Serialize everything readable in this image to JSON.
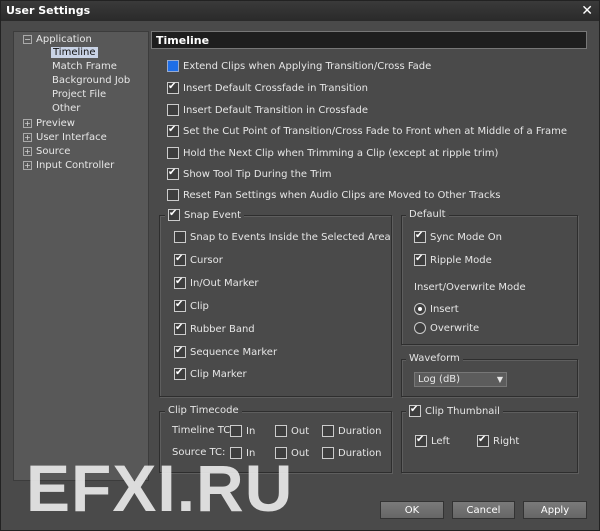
{
  "window": {
    "title": "User Settings",
    "close": "✕"
  },
  "tree": [
    {
      "label": "Application",
      "expander": "−"
    },
    {
      "label": "Timeline"
    },
    {
      "label": "Match Frame"
    },
    {
      "label": "Background Job"
    },
    {
      "label": "Project File"
    },
    {
      "label": "Other"
    },
    {
      "label": "Preview",
      "expander": "+"
    },
    {
      "label": "User Interface",
      "expander": "+"
    },
    {
      "label": "Source",
      "expander": "+"
    },
    {
      "label": "Input Controller",
      "expander": "+"
    }
  ],
  "header": "Timeline",
  "options": [
    {
      "label": "Extend Clips when Applying Transition/Cross Fade",
      "checked": false,
      "focused": true
    },
    {
      "label": "Insert Default Crossfade in Transition",
      "checked": true
    },
    {
      "label": "Insert Default Transition in Crossfade",
      "checked": false
    },
    {
      "label": "Set the Cut Point of Transition/Cross Fade to Front when at Middle of a Frame",
      "checked": true
    },
    {
      "label": "Hold the Next Clip when Trimming a Clip (except at ripple trim)",
      "checked": false
    },
    {
      "label": "Show Tool Tip During the Trim",
      "checked": true
    },
    {
      "label": "Reset Pan Settings when Audio Clips are Moved to Other Tracks",
      "checked": false
    }
  ],
  "snap": {
    "label": "Snap Event",
    "checked": true,
    "items": [
      {
        "label": "Snap to Events Inside the Selected Area",
        "checked": false
      },
      {
        "label": "Cursor",
        "checked": true
      },
      {
        "label": "In/Out Marker",
        "checked": true
      },
      {
        "label": "Clip",
        "checked": true
      },
      {
        "label": "Rubber Band",
        "checked": true
      },
      {
        "label": "Sequence Marker",
        "checked": true
      },
      {
        "label": "Clip Marker",
        "checked": true
      }
    ]
  },
  "default": {
    "label": "Default",
    "sync": "Sync Mode On",
    "ripple": "Ripple Mode",
    "mode_label": "Insert/Overwrite Mode",
    "insert": "Insert",
    "overwrite": "Overwrite",
    "selected_mode": "Insert"
  },
  "waveform": {
    "label": "Waveform",
    "value": "Log (dB)"
  },
  "timecode": {
    "label": "Clip Timecode",
    "timeline": "Timeline TC:",
    "source": "Source TC:",
    "in": "In",
    "out": "Out",
    "duration": "Duration"
  },
  "thumbnail": {
    "label": "Clip Thumbnail",
    "left": "Left",
    "right": "Right"
  },
  "buttons": {
    "ok": "OK",
    "cancel": "Cancel",
    "apply": "Apply"
  },
  "watermark": "EFXI.RU"
}
